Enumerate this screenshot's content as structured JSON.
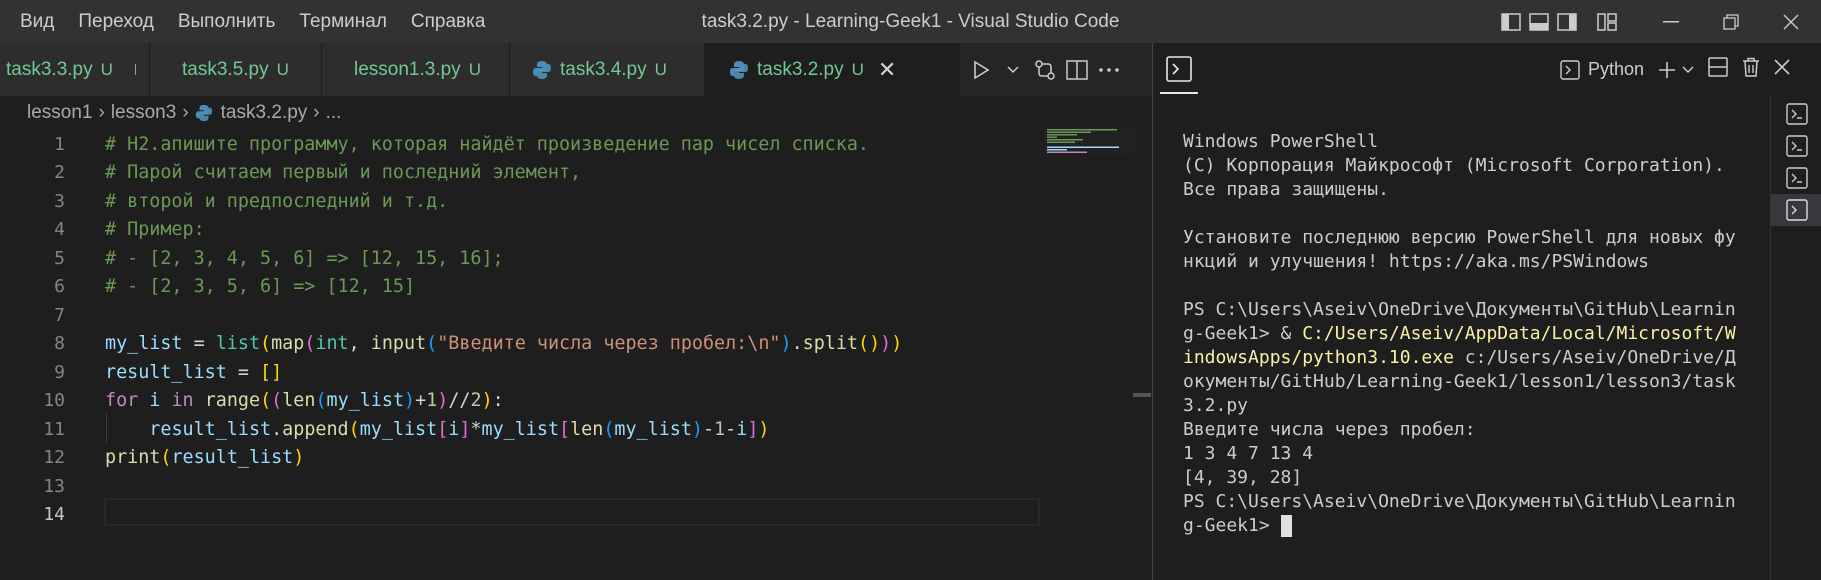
{
  "menu": [
    "Вид",
    "Переход",
    "Выполнить",
    "Терминал",
    "Справка"
  ],
  "window_title": "task3.2.py - Learning-Geek1 - Visual Studio Code",
  "tabs": [
    {
      "name": "task3.3.py",
      "status": "U",
      "python_icon": false,
      "dirty": true
    },
    {
      "name": "task3.5.py",
      "status": "U",
      "python_icon": true,
      "dirty": true
    },
    {
      "name": "lesson1.3.py",
      "status": "U",
      "python_icon": true,
      "dirty": true
    },
    {
      "name": "task3.4.py",
      "status": "U",
      "python_icon": true,
      "dirty": false
    },
    {
      "name": "task3.2.py",
      "status": "U",
      "python_icon": true,
      "active": true
    }
  ],
  "breadcrumb": {
    "folder1": "lesson1",
    "folder2": "lesson3",
    "file": "task3.2.py",
    "symbol": "..."
  },
  "code_lines": [
    "1",
    "2",
    "3",
    "4",
    "5",
    "6",
    "7",
    "8",
    "9",
    "10",
    "11",
    "12",
    "13",
    "14"
  ],
  "code": {
    "l1": "# Н2.апишите программу, которая найдёт произведение пар чисел списка.",
    "l2": "# Парой считаем первый и последний элемент,",
    "l3": "# второй и предпоследний и т.д.",
    "l4": "# Пример:",
    "l5": "# - [2, 3, 4, 5, 6] => [12, 15, 16];",
    "l6": "# - [2, 3, 5, 6] => [12, 15]",
    "l8_str": "\"Введите числа через пробел:\\n\""
  },
  "terminal": {
    "profile_label": "Python",
    "lines": [
      "Windows PowerShell",
      "(C) Корпорация Майкрософт (Microsoft Corporation).",
      "Все права защищены.",
      "",
      "Установите последнюю версию PowerShell для новых фу",
      "нкций и улучшения! https://aka.ms/PSWindows",
      ""
    ],
    "prompt1_a": "PS C:\\Users\\Aseiv\\OneDrive\\Документы\\GitHub\\Learnin",
    "prompt1_b": "g-Geek1> & ",
    "exe_a": "C:/Users/Aseiv/AppData/Local/Microsoft/W",
    "exe_b": "indowsApps/python3.10.exe",
    "arg_a": " c:/Users/Aseiv/OneDrive/Д",
    "arg_b": "окументы/GitHub/Learning-Geek1/lesson1/lesson3/task",
    "arg_c": "3.2.py",
    "out1": "Введите числа через пробел:",
    "out2": "1 3 4 7 13 4",
    "out3": "[4, 39, 28]",
    "prompt2_a": "PS C:\\Users\\Aseiv\\OneDrive\\Документы\\GitHub\\Learnin",
    "prompt2_b": "g-Geek1> "
  },
  "icons": [
    "layout-sidebar-left-icon",
    "layout-panel-icon",
    "layout-sidebar-right-icon",
    "customize-layout-icon",
    "run-icon",
    "source-control-icon",
    "split-editor-icon",
    "more-icon",
    "terminal-icon",
    "add-icon",
    "split-terminal-icon",
    "trash-icon",
    "close-icon"
  ],
  "colors": {
    "accent_untracked": "#73c991",
    "comment": "#6a9955",
    "keyword": "#c586c0",
    "string": "#ce9178"
  }
}
